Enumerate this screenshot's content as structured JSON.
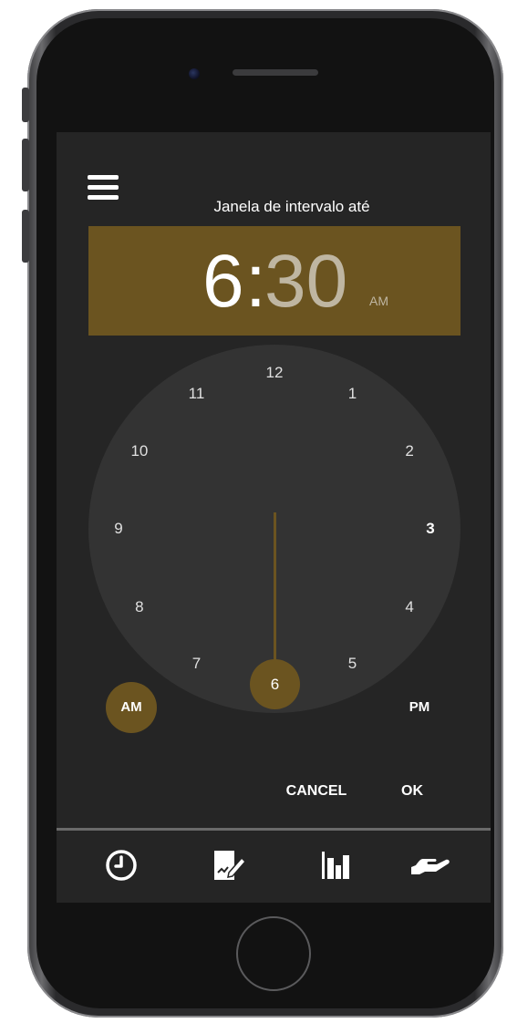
{
  "header": {
    "title": "Janela de intervalo até"
  },
  "time_display": {
    "hour": "6",
    "separator": ":",
    "minute": "30",
    "period": "AM"
  },
  "clock_face": {
    "numbers": [
      "12",
      "1",
      "2",
      "3",
      "4",
      "5",
      "6",
      "7",
      "8",
      "9",
      "10",
      "11"
    ],
    "selected": "6"
  },
  "period_toggle": {
    "am_label": "AM",
    "pm_label": "PM",
    "selected": "AM"
  },
  "actions": {
    "cancel_label": "CANCEL",
    "ok_label": "OK"
  },
  "tabs": [
    {
      "icon": "clock-icon"
    },
    {
      "icon": "edit-document-icon"
    },
    {
      "icon": "bar-chart-icon"
    },
    {
      "icon": "hand-icon"
    }
  ],
  "colors": {
    "accent": "#6b5420",
    "screen_bg": "#252525",
    "dial_bg": "#333333",
    "minute_text": "#bfb6a2"
  }
}
